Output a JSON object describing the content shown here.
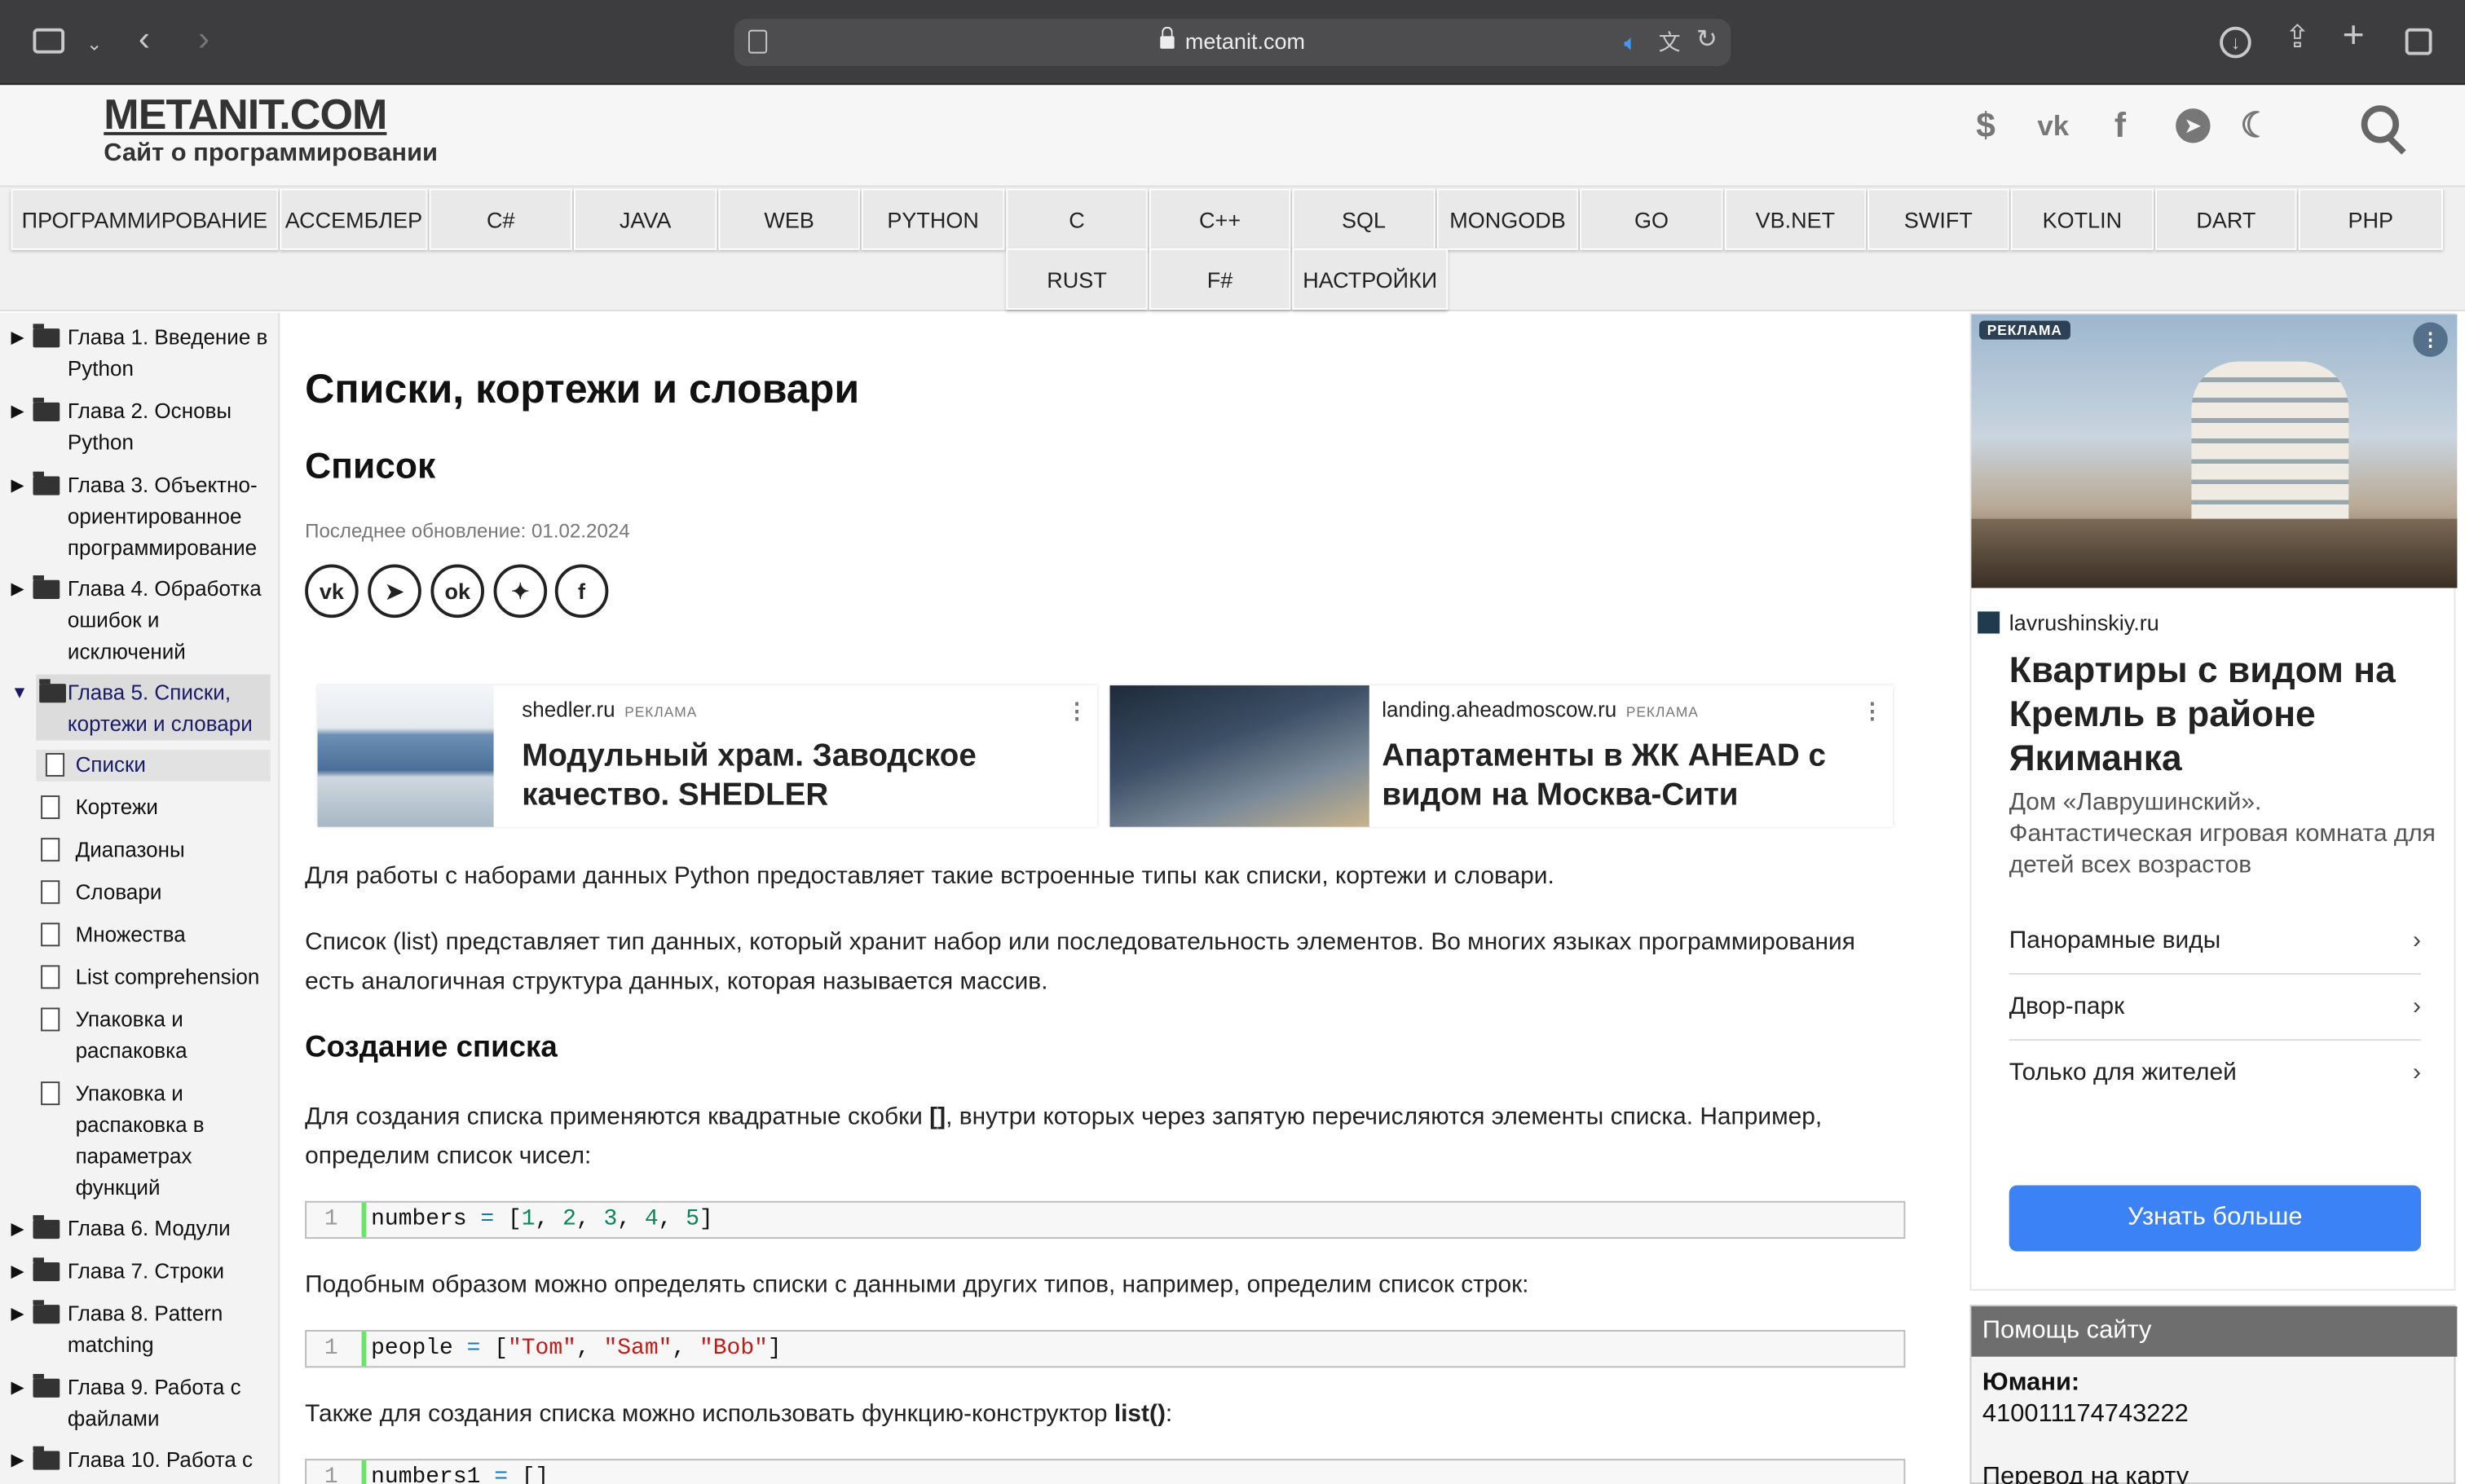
{
  "browser": {
    "url": "metanit.com"
  },
  "site": {
    "logo": "METANIT.COM",
    "slogan": "Сайт о программировании"
  },
  "header_icons": [
    "dollar-icon",
    "vk-icon",
    "facebook-icon",
    "telegram-icon",
    "moon-icon",
    "search-icon"
  ],
  "nav": {
    "row1": [
      "ПРОГРАММИРОВАНИЕ",
      "АССЕМБЛЕР",
      "C#",
      "JAVA",
      "WEB",
      "PYTHON",
      "C",
      "C++",
      "SQL",
      "MONGODB",
      "GO",
      "VB.NET",
      "SWIFT",
      "KOTLIN",
      "DART",
      "PHP"
    ],
    "row2": [
      "RUST",
      "F#",
      "НАСТРОЙКИ"
    ]
  },
  "sidebar": {
    "chapters": [
      {
        "label": "Глава 1. Введение в Python"
      },
      {
        "label": "Глава 2. Основы Python"
      },
      {
        "label": "Глава 3. Объектно-ориентированное программирование"
      },
      {
        "label": "Глава 4. Обработка ошибок и исключений"
      },
      {
        "label": "Глава 5. Списки, кортежи и словари"
      },
      {
        "label": "Глава 6. Модули"
      },
      {
        "label": "Глава 7. Строки"
      },
      {
        "label": "Глава 8. Pattern matching"
      },
      {
        "label": "Глава 9. Работа с файлами"
      },
      {
        "label": "Глава 10. Работа с"
      }
    ],
    "pages": [
      "Списки",
      "Кортежи",
      "Диапазоны",
      "Словари",
      "Множества",
      "List comprehension",
      "Упаковка и распаковка",
      "Упаковка и распаковка в параметрах функций"
    ]
  },
  "article": {
    "title": "Списки, кортежи и словари",
    "subtitle": "Список",
    "updated": "Последнее обновление: 01.02.2024",
    "share_icons": [
      "vk-icon",
      "telegram-icon",
      "odnoklassniki-icon",
      "twitter-icon",
      "facebook-icon"
    ],
    "p1": "Для работы с наборами данных Python предоставляет такие встроенные типы как списки, кортежи и словари.",
    "p2": "Список (list) представляет тип данных, который хранит набор или последовательность элементов. Во многих языках программирования есть аналогичная структура данных, которая называется массив.",
    "h3": "Создание списка",
    "p3a": "Для создания списка применяются квадратные скобки ",
    "p3b": "[]",
    "p3c": ", внутри которых через запятую перечисляются элементы списка. Например, определим список чисел:",
    "p4": "Подобным образом можно определять списки с данными других типов, например, определим список строк:",
    "p5a": "Также для создания списка можно использовать функцию-конструктор ",
    "p5b": "list()",
    "p5c": ":",
    "line_no": "1"
  },
  "ads": {
    "ad1": {
      "domain": "shedler.ru",
      "tag": "РЕКЛАМА",
      "headline": "Модульный храм. Заводское качество. SHEDLER"
    },
    "ad2": {
      "domain": "landing.aheadmoscow.ru",
      "tag": "РЕКЛАМА",
      "headline": "Апартаменты в ЖК AHEAD с видом на Москва-Сити"
    },
    "right": {
      "tag": "РЕКЛАМА",
      "domain": "lavrushinskiy.ru",
      "headline": "Квартиры с видом на Кремль в районе Якиманка",
      "text": "Дом «Лаврушинский». Фантастическая игровая комната для детей всех возрастов",
      "links": [
        "Панорамные виды",
        "Двор-парк",
        "Только для жителей"
      ],
      "button": "Узнать больше"
    }
  },
  "help": {
    "title": "Помощь сайту",
    "yoomoney_label": "Юмани:",
    "yoomoney_number": "410011174743222",
    "card_label": "Перевод на карту"
  }
}
